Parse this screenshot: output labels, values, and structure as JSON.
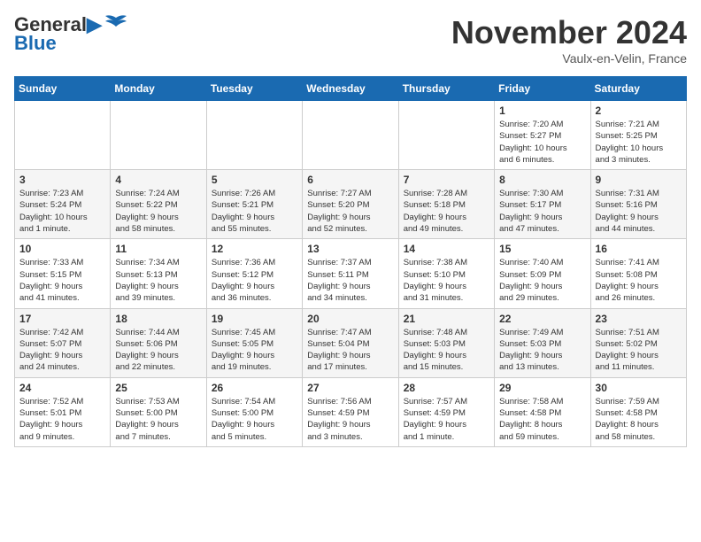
{
  "header": {
    "logo_line1": "General",
    "logo_line2": "Blue",
    "month_title": "November 2024",
    "location": "Vaulx-en-Velin, France"
  },
  "weekdays": [
    "Sunday",
    "Monday",
    "Tuesday",
    "Wednesday",
    "Thursday",
    "Friday",
    "Saturday"
  ],
  "weeks": [
    [
      {
        "day": "",
        "info": ""
      },
      {
        "day": "",
        "info": ""
      },
      {
        "day": "",
        "info": ""
      },
      {
        "day": "",
        "info": ""
      },
      {
        "day": "",
        "info": ""
      },
      {
        "day": "1",
        "info": "Sunrise: 7:20 AM\nSunset: 5:27 PM\nDaylight: 10 hours\nand 6 minutes."
      },
      {
        "day": "2",
        "info": "Sunrise: 7:21 AM\nSunset: 5:25 PM\nDaylight: 10 hours\nand 3 minutes."
      }
    ],
    [
      {
        "day": "3",
        "info": "Sunrise: 7:23 AM\nSunset: 5:24 PM\nDaylight: 10 hours\nand 1 minute."
      },
      {
        "day": "4",
        "info": "Sunrise: 7:24 AM\nSunset: 5:22 PM\nDaylight: 9 hours\nand 58 minutes."
      },
      {
        "day": "5",
        "info": "Sunrise: 7:26 AM\nSunset: 5:21 PM\nDaylight: 9 hours\nand 55 minutes."
      },
      {
        "day": "6",
        "info": "Sunrise: 7:27 AM\nSunset: 5:20 PM\nDaylight: 9 hours\nand 52 minutes."
      },
      {
        "day": "7",
        "info": "Sunrise: 7:28 AM\nSunset: 5:18 PM\nDaylight: 9 hours\nand 49 minutes."
      },
      {
        "day": "8",
        "info": "Sunrise: 7:30 AM\nSunset: 5:17 PM\nDaylight: 9 hours\nand 47 minutes."
      },
      {
        "day": "9",
        "info": "Sunrise: 7:31 AM\nSunset: 5:16 PM\nDaylight: 9 hours\nand 44 minutes."
      }
    ],
    [
      {
        "day": "10",
        "info": "Sunrise: 7:33 AM\nSunset: 5:15 PM\nDaylight: 9 hours\nand 41 minutes."
      },
      {
        "day": "11",
        "info": "Sunrise: 7:34 AM\nSunset: 5:13 PM\nDaylight: 9 hours\nand 39 minutes."
      },
      {
        "day": "12",
        "info": "Sunrise: 7:36 AM\nSunset: 5:12 PM\nDaylight: 9 hours\nand 36 minutes."
      },
      {
        "day": "13",
        "info": "Sunrise: 7:37 AM\nSunset: 5:11 PM\nDaylight: 9 hours\nand 34 minutes."
      },
      {
        "day": "14",
        "info": "Sunrise: 7:38 AM\nSunset: 5:10 PM\nDaylight: 9 hours\nand 31 minutes."
      },
      {
        "day": "15",
        "info": "Sunrise: 7:40 AM\nSunset: 5:09 PM\nDaylight: 9 hours\nand 29 minutes."
      },
      {
        "day": "16",
        "info": "Sunrise: 7:41 AM\nSunset: 5:08 PM\nDaylight: 9 hours\nand 26 minutes."
      }
    ],
    [
      {
        "day": "17",
        "info": "Sunrise: 7:42 AM\nSunset: 5:07 PM\nDaylight: 9 hours\nand 24 minutes."
      },
      {
        "day": "18",
        "info": "Sunrise: 7:44 AM\nSunset: 5:06 PM\nDaylight: 9 hours\nand 22 minutes."
      },
      {
        "day": "19",
        "info": "Sunrise: 7:45 AM\nSunset: 5:05 PM\nDaylight: 9 hours\nand 19 minutes."
      },
      {
        "day": "20",
        "info": "Sunrise: 7:47 AM\nSunset: 5:04 PM\nDaylight: 9 hours\nand 17 minutes."
      },
      {
        "day": "21",
        "info": "Sunrise: 7:48 AM\nSunset: 5:03 PM\nDaylight: 9 hours\nand 15 minutes."
      },
      {
        "day": "22",
        "info": "Sunrise: 7:49 AM\nSunset: 5:03 PM\nDaylight: 9 hours\nand 13 minutes."
      },
      {
        "day": "23",
        "info": "Sunrise: 7:51 AM\nSunset: 5:02 PM\nDaylight: 9 hours\nand 11 minutes."
      }
    ],
    [
      {
        "day": "24",
        "info": "Sunrise: 7:52 AM\nSunset: 5:01 PM\nDaylight: 9 hours\nand 9 minutes."
      },
      {
        "day": "25",
        "info": "Sunrise: 7:53 AM\nSunset: 5:00 PM\nDaylight: 9 hours\nand 7 minutes."
      },
      {
        "day": "26",
        "info": "Sunrise: 7:54 AM\nSunset: 5:00 PM\nDaylight: 9 hours\nand 5 minutes."
      },
      {
        "day": "27",
        "info": "Sunrise: 7:56 AM\nSunset: 4:59 PM\nDaylight: 9 hours\nand 3 minutes."
      },
      {
        "day": "28",
        "info": "Sunrise: 7:57 AM\nSunset: 4:59 PM\nDaylight: 9 hours\nand 1 minute."
      },
      {
        "day": "29",
        "info": "Sunrise: 7:58 AM\nSunset: 4:58 PM\nDaylight: 8 hours\nand 59 minutes."
      },
      {
        "day": "30",
        "info": "Sunrise: 7:59 AM\nSunset: 4:58 PM\nDaylight: 8 hours\nand 58 minutes."
      }
    ]
  ]
}
